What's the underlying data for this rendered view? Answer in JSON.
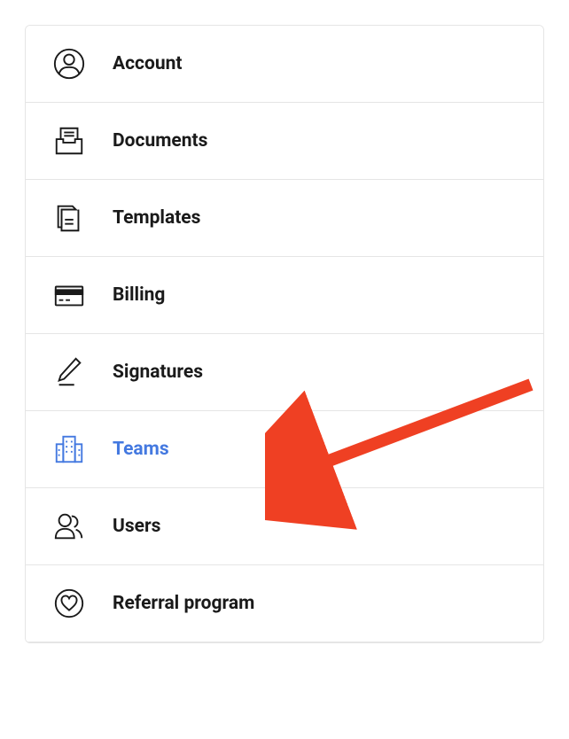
{
  "menu": {
    "items": [
      {
        "id": "account",
        "label": "Account",
        "icon": "person-circle-icon",
        "active": false
      },
      {
        "id": "documents",
        "label": "Documents",
        "icon": "documents-tray-icon",
        "active": false
      },
      {
        "id": "templates",
        "label": "Templates",
        "icon": "templates-icon",
        "active": false
      },
      {
        "id": "billing",
        "label": "Billing",
        "icon": "credit-card-icon",
        "active": false
      },
      {
        "id": "signatures",
        "label": "Signatures",
        "icon": "pencil-signature-icon",
        "active": false
      },
      {
        "id": "teams",
        "label": "Teams",
        "icon": "building-icon",
        "active": true
      },
      {
        "id": "users",
        "label": "Users",
        "icon": "users-icon",
        "active": false
      },
      {
        "id": "referral",
        "label": "Referral program",
        "icon": "heart-circle-icon",
        "active": false
      }
    ]
  },
  "annotation": {
    "arrow_color": "#ef4023",
    "target": "teams"
  }
}
